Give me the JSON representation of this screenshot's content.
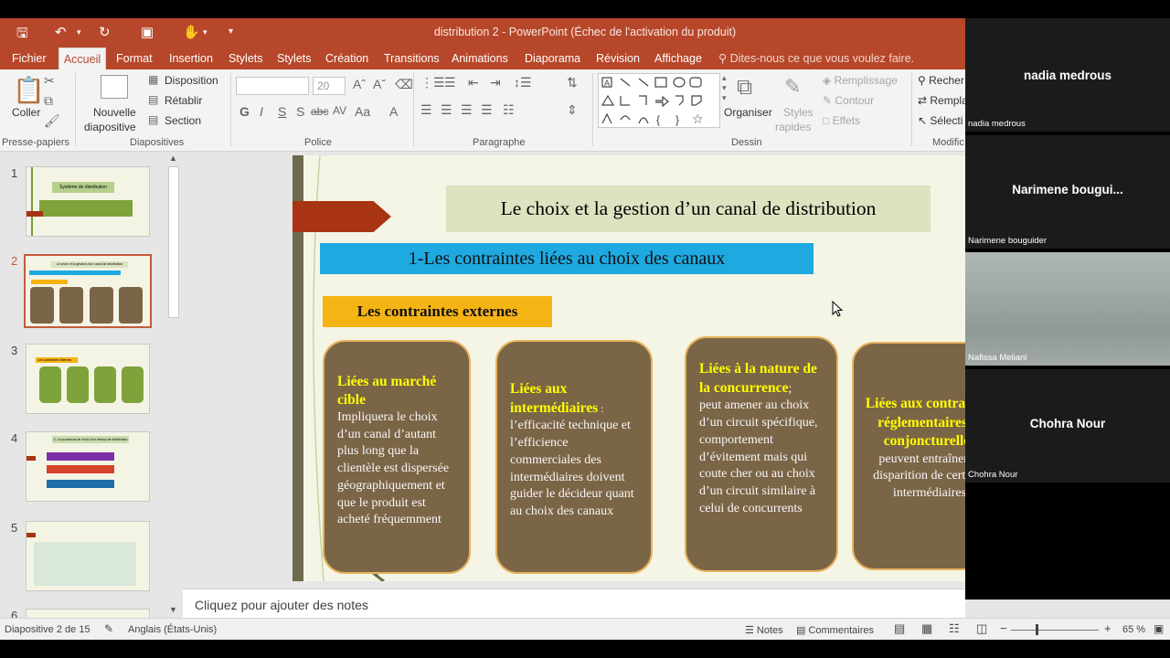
{
  "window": {
    "title": "distribution 2 - PowerPoint (Échec de l'activation du produit)"
  },
  "tabs": [
    {
      "label": "Fichier"
    },
    {
      "label": "Accueil"
    },
    {
      "label": "Format"
    },
    {
      "label": "Insertion"
    },
    {
      "label": "Stylets"
    },
    {
      "label": "Stylets"
    },
    {
      "label": "Création"
    },
    {
      "label": "Transitions"
    },
    {
      "label": "Animations"
    },
    {
      "label": "Diaporama"
    },
    {
      "label": "Révision"
    },
    {
      "label": "Affichage"
    }
  ],
  "tell_me": "Dites-nous ce que vous voulez faire.",
  "ribbon": {
    "clipboard": {
      "paste": "Coller",
      "group": "Presse-papiers"
    },
    "slides": {
      "new_slide_line1": "Nouvelle",
      "new_slide_line2": "diapositive",
      "layout": "Disposition",
      "reset": "Rétablir",
      "section": "Section",
      "group": "Diapositives"
    },
    "font": {
      "size": "20",
      "group": "Police",
      "bold": "G",
      "italic": "I",
      "underline": "S",
      "shadow": "S",
      "strike": "abc",
      "spacing": "AV",
      "case": "Aa",
      "color": "A"
    },
    "paragraph": {
      "group": "Paragraphe"
    },
    "drawing": {
      "arrange": "Organiser",
      "quick_styles_line1": "Styles",
      "quick_styles_line2": "rapides",
      "fill": "Remplissage",
      "outline": "Contour",
      "effects": "Effets",
      "group": "Dessin"
    },
    "editing": {
      "find": "Recher",
      "replace": "Rempla",
      "select": "Sélecti",
      "group": "Modific"
    }
  },
  "thumbnails": [
    {
      "num": "1",
      "title": "Système de distribution"
    },
    {
      "num": "2",
      "title": "Le choix et la gestion d'un canal de distribution"
    },
    {
      "num": "3",
      "title": "Les contraintes internes"
    },
    {
      "num": "4",
      "title": "2- Le processus de choix d'un réseau de distribution"
    },
    {
      "num": "5",
      "title": ""
    },
    {
      "num": "6",
      "title": ""
    }
  ],
  "slide": {
    "title": "Le choix et la gestion d’un canal de distribution",
    "subtitle": "1-Les contraintes liées au choix des canaux",
    "section": "Les contraintes externes",
    "cards": [
      {
        "heading": "Liées au marché cible",
        "body": "Impliquera le choix d’un canal d’autant plus long que la clientèle est dispersée géographiquement et que le produit est acheté fréquemment"
      },
      {
        "heading": "Liées aux intermédiaires",
        "sep": " :",
        "body": "l’efficacité technique et l’efficience commerciales des intermédiaires doivent guider le décideur quant au choix des canaux"
      },
      {
        "heading": "Liées à la nature de la concurrence",
        "sep": ";",
        "body": " peut amener au choix d’un circuit spécifique, comportement d’évitement mais qui coute cher ou au choix d’un circuit similaire à celui de concurrents"
      },
      {
        "heading": "Liées aux contraintes réglementaires et conjoncturelles",
        "body": "peuvent entraîner la disparition de certains intermédiaires"
      }
    ]
  },
  "notes_placeholder": "Cliquez pour ajouter des notes",
  "status": {
    "slide_count": "Diapositive 2 de 15",
    "language": "Anglais (États-Unis)",
    "notes": "Notes",
    "comments": "Commentaires",
    "zoom": "65 %"
  },
  "participants": [
    {
      "display": "nadia medrous",
      "label": "nadia medrous"
    },
    {
      "display": "Narimene  bougui...",
      "label": "Narimene bouguider"
    },
    {
      "display": "",
      "label": "Nafissa Meliani"
    },
    {
      "display": "Chohra Nour",
      "label": "Chohra Nour"
    }
  ],
  "colors": {
    "accent": "#b7472a",
    "slide_bg": "#f5f5e6",
    "card": "#7b6547",
    "card_heading": "#ffff00",
    "subtitle_bg": "#1fa9e1",
    "section_bg": "#f6b414"
  }
}
